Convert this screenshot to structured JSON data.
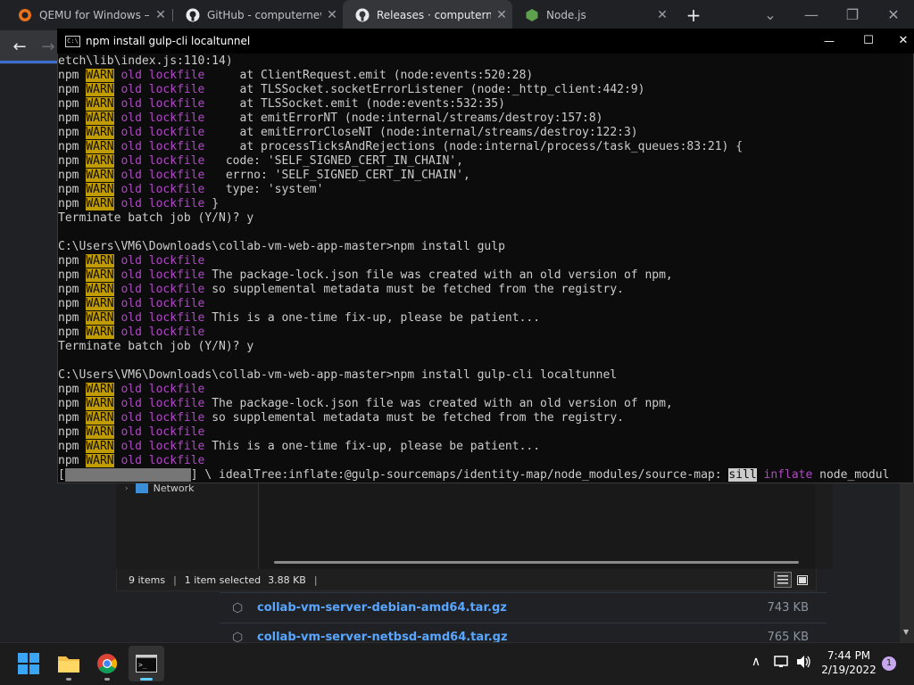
{
  "browser": {
    "tabs": [
      {
        "title": "QEMU for Windows – I",
        "icon": "qemu-icon",
        "active": false
      },
      {
        "title": "GitHub - computernew",
        "icon": "github-icon",
        "active": false
      },
      {
        "title": "Releases · computerne",
        "icon": "github-icon",
        "active": true
      },
      {
        "title": "Node.js",
        "icon": "nodejs-icon",
        "active": false
      }
    ],
    "new_tab": "+",
    "tab_close": "✕",
    "tab_search": "⌄",
    "minimize": "—",
    "restore": "❐",
    "close": "✕",
    "back": "←",
    "forward": "→"
  },
  "console": {
    "title": "npm install gulp-cli localtunnel",
    "minimize": "—",
    "maximize": "☐",
    "close": "✕",
    "lines": [
      {
        "parts": [
          {
            "t": "etch\\lib\\index.js:110:14)"
          }
        ]
      },
      {
        "parts": [
          {
            "t": "npm "
          },
          {
            "t": "WARN",
            "c": "warn"
          },
          {
            "t": " "
          },
          {
            "t": "old lockfile",
            "c": "mag"
          },
          {
            "t": "     at ClientRequest.emit (node:events:520:28)"
          }
        ]
      },
      {
        "parts": [
          {
            "t": "npm "
          },
          {
            "t": "WARN",
            "c": "warn"
          },
          {
            "t": " "
          },
          {
            "t": "old lockfile",
            "c": "mag"
          },
          {
            "t": "     at TLSSocket.socketErrorListener (node:_http_client:442:9)"
          }
        ]
      },
      {
        "parts": [
          {
            "t": "npm "
          },
          {
            "t": "WARN",
            "c": "warn"
          },
          {
            "t": " "
          },
          {
            "t": "old lockfile",
            "c": "mag"
          },
          {
            "t": "     at TLSSocket.emit (node:events:532:35)"
          }
        ]
      },
      {
        "parts": [
          {
            "t": "npm "
          },
          {
            "t": "WARN",
            "c": "warn"
          },
          {
            "t": " "
          },
          {
            "t": "old lockfile",
            "c": "mag"
          },
          {
            "t": "     at emitErrorNT (node:internal/streams/destroy:157:8)"
          }
        ]
      },
      {
        "parts": [
          {
            "t": "npm "
          },
          {
            "t": "WARN",
            "c": "warn"
          },
          {
            "t": " "
          },
          {
            "t": "old lockfile",
            "c": "mag"
          },
          {
            "t": "     at emitErrorCloseNT (node:internal/streams/destroy:122:3)"
          }
        ]
      },
      {
        "parts": [
          {
            "t": "npm "
          },
          {
            "t": "WARN",
            "c": "warn"
          },
          {
            "t": " "
          },
          {
            "t": "old lockfile",
            "c": "mag"
          },
          {
            "t": "     at processTicksAndRejections (node:internal/process/task_queues:83:21) {"
          }
        ]
      },
      {
        "parts": [
          {
            "t": "npm "
          },
          {
            "t": "WARN",
            "c": "warn"
          },
          {
            "t": " "
          },
          {
            "t": "old lockfile",
            "c": "mag"
          },
          {
            "t": "   code: 'SELF_SIGNED_CERT_IN_CHAIN',"
          }
        ]
      },
      {
        "parts": [
          {
            "t": "npm "
          },
          {
            "t": "WARN",
            "c": "warn"
          },
          {
            "t": " "
          },
          {
            "t": "old lockfile",
            "c": "mag"
          },
          {
            "t": "   errno: 'SELF_SIGNED_CERT_IN_CHAIN',"
          }
        ]
      },
      {
        "parts": [
          {
            "t": "npm "
          },
          {
            "t": "WARN",
            "c": "warn"
          },
          {
            "t": " "
          },
          {
            "t": "old lockfile",
            "c": "mag"
          },
          {
            "t": "   type: 'system'"
          }
        ]
      },
      {
        "parts": [
          {
            "t": "npm "
          },
          {
            "t": "WARN",
            "c": "warn"
          },
          {
            "t": " "
          },
          {
            "t": "old lockfile",
            "c": "mag"
          },
          {
            "t": " }"
          }
        ]
      },
      {
        "parts": [
          {
            "t": "Terminate batch job (Y/N)? y"
          }
        ]
      },
      {
        "parts": [
          {
            "t": ""
          }
        ]
      },
      {
        "parts": [
          {
            "t": "C:\\Users\\VM6\\Downloads\\collab-vm-web-app-master>npm install gulp"
          }
        ]
      },
      {
        "parts": [
          {
            "t": "npm "
          },
          {
            "t": "WARN",
            "c": "warn"
          },
          {
            "t": " "
          },
          {
            "t": "old lockfile",
            "c": "mag"
          }
        ]
      },
      {
        "parts": [
          {
            "t": "npm "
          },
          {
            "t": "WARN",
            "c": "warn"
          },
          {
            "t": " "
          },
          {
            "t": "old lockfile",
            "c": "mag"
          },
          {
            "t": " The package-lock.json file was created with an old version of npm,"
          }
        ]
      },
      {
        "parts": [
          {
            "t": "npm "
          },
          {
            "t": "WARN",
            "c": "warn"
          },
          {
            "t": " "
          },
          {
            "t": "old lockfile",
            "c": "mag"
          },
          {
            "t": " so supplemental metadata must be fetched from the registry."
          }
        ]
      },
      {
        "parts": [
          {
            "t": "npm "
          },
          {
            "t": "WARN",
            "c": "warn"
          },
          {
            "t": " "
          },
          {
            "t": "old lockfile",
            "c": "mag"
          }
        ]
      },
      {
        "parts": [
          {
            "t": "npm "
          },
          {
            "t": "WARN",
            "c": "warn"
          },
          {
            "t": " "
          },
          {
            "t": "old lockfile",
            "c": "mag"
          },
          {
            "t": " This is a one-time fix-up, please be patient..."
          }
        ]
      },
      {
        "parts": [
          {
            "t": "npm "
          },
          {
            "t": "WARN",
            "c": "warn"
          },
          {
            "t": " "
          },
          {
            "t": "old lockfile",
            "c": "mag"
          }
        ]
      },
      {
        "parts": [
          {
            "t": "Terminate batch job (Y/N)? y"
          }
        ]
      },
      {
        "parts": [
          {
            "t": ""
          }
        ]
      },
      {
        "parts": [
          {
            "t": "C:\\Users\\VM6\\Downloads\\collab-vm-web-app-master>npm install gulp-cli localtunnel"
          }
        ]
      },
      {
        "parts": [
          {
            "t": "npm "
          },
          {
            "t": "WARN",
            "c": "warn"
          },
          {
            "t": " "
          },
          {
            "t": "old lockfile",
            "c": "mag"
          }
        ]
      },
      {
        "parts": [
          {
            "t": "npm "
          },
          {
            "t": "WARN",
            "c": "warn"
          },
          {
            "t": " "
          },
          {
            "t": "old lockfile",
            "c": "mag"
          },
          {
            "t": " The package-lock.json file was created with an old version of npm,"
          }
        ]
      },
      {
        "parts": [
          {
            "t": "npm "
          },
          {
            "t": "WARN",
            "c": "warn"
          },
          {
            "t": " "
          },
          {
            "t": "old lockfile",
            "c": "mag"
          },
          {
            "t": " so supplemental metadata must be fetched from the registry."
          }
        ]
      },
      {
        "parts": [
          {
            "t": "npm "
          },
          {
            "t": "WARN",
            "c": "warn"
          },
          {
            "t": " "
          },
          {
            "t": "old lockfile",
            "c": "mag"
          }
        ]
      },
      {
        "parts": [
          {
            "t": "npm "
          },
          {
            "t": "WARN",
            "c": "warn"
          },
          {
            "t": " "
          },
          {
            "t": "old lockfile",
            "c": "mag"
          },
          {
            "t": " This is a one-time fix-up, please be patient..."
          }
        ]
      },
      {
        "parts": [
          {
            "t": "npm "
          },
          {
            "t": "WARN",
            "c": "warn"
          },
          {
            "t": " "
          },
          {
            "t": "old lockfile",
            "c": "mag"
          }
        ]
      },
      {
        "parts": [
          {
            "t": "["
          },
          {
            "t": "                  ",
            "c": "pbar"
          },
          {
            "t": "] \\ idealTree:inflate:@gulp-sourcemaps/identity-map/node_modules/source-map: "
          },
          {
            "t": "sill",
            "c": "sill"
          },
          {
            "t": " "
          },
          {
            "t": "inflate",
            "c": "mag"
          },
          {
            "t": " node_modul"
          }
        ]
      }
    ]
  },
  "explorer": {
    "nav_item": "Network",
    "status_items": "9 items",
    "status_selected": "1 item selected",
    "status_size": "3.88 KB",
    "separator": "|"
  },
  "releases": {
    "assets": [
      {
        "name": "collab-vm-server-debian-amd64.tar.gz",
        "size": "743 KB"
      },
      {
        "name": "collab-vm-server-netbsd-amd64.tar.gz",
        "size": "765 KB"
      }
    ]
  },
  "taskbar": {
    "time": "7:44 PM",
    "date": "2/19/2022",
    "notification_count": "1"
  },
  "colors": {
    "warn_bg": "#c19c00",
    "magenta": "#b148c6",
    "link_blue": "#58a6ff"
  }
}
